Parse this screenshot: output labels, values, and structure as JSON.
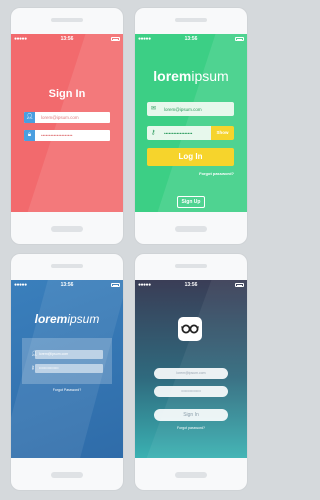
{
  "statusbar": {
    "time": "13:56"
  },
  "screen_signin_red": {
    "title": "Sign In",
    "email_value": "lorem@ipsum.com",
    "password_value": "••••••••••••••••••••",
    "colors": {
      "background": "#f26a6d",
      "icon": "#4a9fe0"
    }
  },
  "screen_green": {
    "logo_bold": "lorem",
    "logo_light": "ipsum",
    "email_value": "lorem@ipsum.com",
    "password_value": "••••••••••••••••••",
    "show_label": "Show",
    "login_label": "Log In",
    "forgot_label": "Forgot password?",
    "signup_label": "Sign Up",
    "colors": {
      "background": "#3ccf85",
      "accent": "#f6d42c"
    }
  },
  "screen_blue": {
    "logo_bold": "lorem",
    "logo_light": "ipsum",
    "email_value": "lorem@ipsum.com",
    "password_value": "••••••••••••••••",
    "forgot_label": "Forgot Password?",
    "colors": {
      "background": "#3a7fbc"
    }
  },
  "screen_dark": {
    "logo_icon": "glasses-icon",
    "email_placeholder": "lorem@ipsum.com",
    "password_placeholder": "••••••••••••••••",
    "signin_label": "Sign In",
    "forgot_label": "Forgot password?",
    "colors": {
      "gradient_top": "#3a3d56",
      "gradient_bottom": "#3ab1b2"
    }
  }
}
